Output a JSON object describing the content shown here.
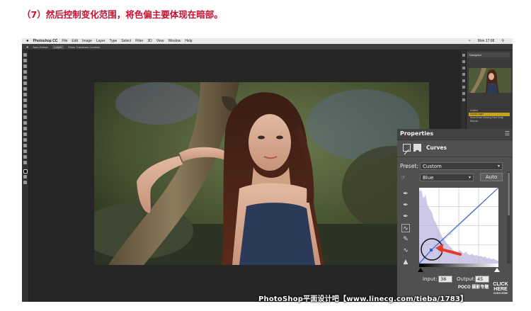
{
  "caption": "（7）然后控制变化范围，将色偏主要体现在暗部。",
  "menubar": {
    "apple": "",
    "app": "Photoshop CC",
    "items": [
      "File",
      "Edit",
      "Image",
      "Layer",
      "Type",
      "Select",
      "Filter",
      "3D",
      "View",
      "Window",
      "Help"
    ],
    "clock": "Mon 17:08"
  },
  "options_bar": {
    "auto_select": "Auto-Select:",
    "auto_select_value": "Layer",
    "show_transform": "Show Transform Controls"
  },
  "navigator": {
    "title": "Navigator"
  },
  "history": {
    "items": [
      "Untitled",
      "Curves Layer",
      "Move Brush Clearing Point Setup",
      "Bisector"
    ],
    "active_index": 1
  },
  "properties": {
    "title": "Properties",
    "menu_icon": "hamburger-icon",
    "adjustment_name": "Curves",
    "preset_label": "Preset:",
    "preset_value": "Custom",
    "channel_value": "Blue",
    "auto_label": "Auto",
    "input_label": "Input:",
    "input_value": "38",
    "output_label": "Output:",
    "output_value": "45",
    "curve_color": "#2f5bd8",
    "histogram_color": "#c9c2e6",
    "highlight_circle_color": "#111111",
    "arrow_color": "#e53a2b"
  },
  "watermark": "PhotoShop平面设计吧【www.linecg.com/tieba/1783】",
  "poco": "POCO 摄影专题",
  "click_here": {
    "line1": "CLICK",
    "line2": "HERE",
    "line3": "SUBSCRIBE"
  }
}
